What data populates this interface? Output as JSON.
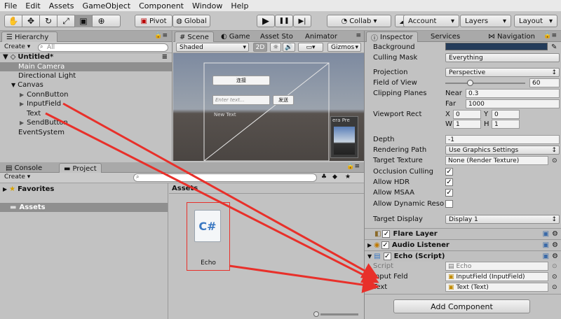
{
  "menu": [
    "File",
    "Edit",
    "Assets",
    "GameObject",
    "Component",
    "Window",
    "Help"
  ],
  "toolbar": {
    "tools": [
      "✋",
      "✥",
      "↻",
      "⤢",
      "▣",
      "⊕"
    ],
    "pivot": "Pivot",
    "global": "Global",
    "play": "▶",
    "pause": "❚❚",
    "step": "▶|",
    "collab": "Collab ▾",
    "cloud": "☁",
    "account": "Account",
    "layers": "Layers",
    "layout": "Layout"
  },
  "hierarchy": {
    "tab": "Hierarchy",
    "create": "Create",
    "search": "All",
    "scene_name": "Untitled*",
    "items": [
      "Main Camera",
      "Directional Light",
      "Canvas",
      "ConnButton",
      "InputField",
      "Text",
      "SendButton",
      "EventSystem"
    ]
  },
  "scene": {
    "tabs": [
      "Scene",
      "Game",
      "Asset Sto",
      "Animator"
    ],
    "shading": "Shaded",
    "mode2d": "2D",
    "gizmos": "Gizmos",
    "connect_btn": "连接",
    "input_placeholder": "Enter text...",
    "send_btn": "发送",
    "new_text": "New Text",
    "camera_preview": "era Pre"
  },
  "project": {
    "tabs": [
      "Console",
      "Project"
    ],
    "create": "Create",
    "favorites": "Favorites",
    "assets_tree": "Assets",
    "assets_header": "Assets",
    "file_name": "Echo",
    "file_glyph": "C#"
  },
  "inspector": {
    "tabs": [
      "Inspector",
      "Services",
      "Navigation"
    ],
    "background_label": "Background",
    "background_color": "#243c5a",
    "culling_label": "Culling Mask",
    "culling_value": "Everything",
    "projection_label": "Projection",
    "projection_value": "Perspective",
    "fov_label": "Field of View",
    "fov_value": "60",
    "fov_fraction": 0.31,
    "clipping_label": "Clipping Planes",
    "near_label": "Near",
    "near_value": "0.3",
    "far_label": "Far",
    "far_value": "1000",
    "viewport_label": "Viewport Rect",
    "vx_label": "X",
    "vx": "0",
    "vy_label": "Y",
    "vy": "0",
    "vw_label": "W",
    "vw": "1",
    "vh_label": "H",
    "vh": "1",
    "depth_label": "Depth",
    "depth_value": "-1",
    "render_path_label": "Rendering Path",
    "render_path_value": "Use Graphics Settings",
    "target_tex_label": "Target Texture",
    "target_tex_value": "None (Render Texture)",
    "occlusion_label": "Occlusion Culling",
    "hdr_label": "Allow HDR",
    "msaa_label": "Allow MSAA",
    "dynres_label": "Allow Dynamic Reso",
    "target_display_label": "Target Display",
    "target_display_value": "Display 1",
    "flare_layer": "Flare Layer",
    "audio_listener": "Audio Listener",
    "echo_script": "Echo (Script)",
    "script_label": "Script",
    "script_value": "Echo",
    "input_feld_label": "Input Feld",
    "input_feld_value": "InputField (InputField)",
    "text_label": "Text",
    "text_value": "Text (Text)",
    "add_component": "Add Component"
  },
  "colors": {
    "arrow": "#e8302a",
    "annotation_box": "#e8302a"
  }
}
